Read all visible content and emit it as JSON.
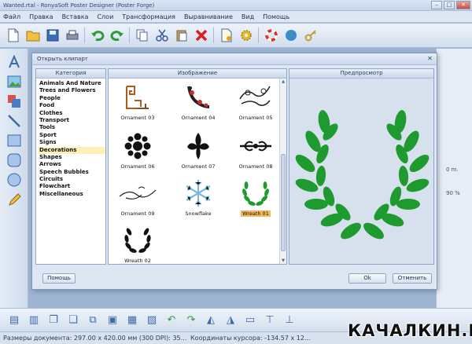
{
  "window": {
    "title": "Wanted.rtal - RonyaSoft Poster Designer (Poster Forge)"
  },
  "menu": [
    "Файл",
    "Правка",
    "Вставка",
    "Слои",
    "Трансформация",
    "Выравнивание",
    "Вид",
    "Помощь"
  ],
  "toolbar_icons": [
    "new-document-icon",
    "open-folder-icon",
    "save-icon",
    "print-icon",
    "undo-icon",
    "redo-icon",
    "copy-icon",
    "cut-icon",
    "paste-icon",
    "delete-icon",
    "document-settings-icon",
    "gear-icon",
    "lifebuoy-icon",
    "globe-icon",
    "key-icon"
  ],
  "left_tools": [
    "text-tool-icon",
    "image-tool-icon",
    "clipart-tool-icon",
    "line-tool-icon",
    "rectangle-tool-icon",
    "rounded-rect-tool-icon",
    "ellipse-tool-icon",
    "pencil-tool-icon"
  ],
  "dialog": {
    "title": "Открыть клипарт",
    "categories_header": "Категория",
    "images_header": "Изображение",
    "preview_header": "Предпросмотр",
    "categories": [
      "Animals And Nature",
      "Trees and Flowers",
      "People",
      "Food",
      "Clothes",
      "Transport",
      "Tools",
      "Sport",
      "Signs",
      "Decorations",
      "Shapes",
      "Arrows",
      "Speech Bubbles",
      "Circuits",
      "Flowchart",
      "Miscellaneous"
    ],
    "selected_category": "Decorations",
    "images": [
      {
        "label": "Ornament 03",
        "icon": "ornament-03-icon"
      },
      {
        "label": "Ornament 04",
        "icon": "ornament-04-icon"
      },
      {
        "label": "Ornament 05",
        "icon": "ornament-05-icon"
      },
      {
        "label": "Ornament 06",
        "icon": "ornament-06-icon"
      },
      {
        "label": "Ornament 07",
        "icon": "ornament-07-icon"
      },
      {
        "label": "Ornament 08",
        "icon": "ornament-08-icon"
      },
      {
        "label": "Ornament 09",
        "icon": "ornament-09-icon"
      },
      {
        "label": "Snowflake",
        "icon": "snowflake-icon"
      },
      {
        "label": "Wreath 01",
        "icon": "wreath-01-icon"
      },
      {
        "label": "Wreath 02",
        "icon": "wreath-02-icon"
      }
    ],
    "selected_image": "Wreath 01",
    "help_label": "Помощь",
    "ok_label": "Ok",
    "cancel_label": "Отменить"
  },
  "right_panel": {
    "value_1": "0 m.",
    "value_2": "90 %"
  },
  "bottom_tools": [
    "align-left-icon",
    "align-center-icon",
    "bring-front-icon",
    "send-back-icon",
    "group-icon",
    "ungroup-icon",
    "layer-up-icon",
    "layer-down-icon",
    "rotate-left-icon",
    "rotate-right-icon",
    "flip-horizontal-icon",
    "flip-vertical-icon",
    "distribute-icon",
    "align-top-icon",
    "align-bottom-icon"
  ],
  "status": {
    "document_size": "Размеры документа: 297.00 x 420.00 мм (300 DPI): 35...",
    "cursor": "Координаты курсора: -134.57 x 12..."
  },
  "watermark": "КАЧАЛКИН.РУ",
  "colors": {
    "wreath_green": "#1f9a2e",
    "selection_label": "#f4b860",
    "category_highlight": "#fff0b8"
  }
}
